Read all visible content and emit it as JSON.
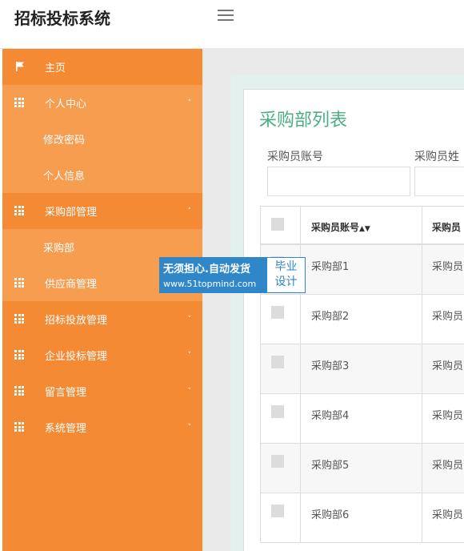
{
  "app": {
    "title": "招标投标系统"
  },
  "sidebar": {
    "items": [
      {
        "label": "主页",
        "icon": "flag-icon"
      },
      {
        "label": "个人中心",
        "icon": "grid-icon",
        "chevron": "˄"
      },
      {
        "label": "修改密码"
      },
      {
        "label": "个人信息"
      },
      {
        "label": "采购部管理",
        "icon": "grid-icon",
        "chevron": "˄"
      },
      {
        "label": "采购部"
      },
      {
        "label": "供应商管理",
        "icon": "grid-icon"
      },
      {
        "label": "招标投放管理",
        "icon": "grid-icon",
        "chevron": "˅"
      },
      {
        "label": "企业投标管理",
        "icon": "grid-icon",
        "chevron": "˅"
      },
      {
        "label": "留言管理",
        "icon": "grid-icon",
        "chevron": "˅"
      },
      {
        "label": "系统管理",
        "icon": "grid-icon",
        "chevron": "˅"
      }
    ]
  },
  "main": {
    "page_title": "采购部列表",
    "filters": {
      "account_label": "采购员账号",
      "name_label": "采购员姓"
    },
    "table": {
      "headers": {
        "account": "采购员账号",
        "name": "采购员"
      },
      "rows": [
        {
          "account": "采购部1",
          "name": "采购员"
        },
        {
          "account": "采购部2",
          "name": "采购员"
        },
        {
          "account": "采购部3",
          "name": "采购员"
        },
        {
          "account": "采购部4",
          "name": "采购员"
        },
        {
          "account": "采购部5",
          "name": "采购员"
        },
        {
          "account": "采购部6",
          "name": "采购员"
        }
      ]
    }
  },
  "watermark": {
    "line1": "无须担心.自动发货",
    "line2": "www.51topmind.com",
    "badge_top": "毕业",
    "badge_bottom": "设计"
  },
  "colors": {
    "sidebar": "#f58a34",
    "sidebar_open": "#f79d4f",
    "title_green": "#4caf82",
    "watermark_blue": "#2f86c8"
  }
}
